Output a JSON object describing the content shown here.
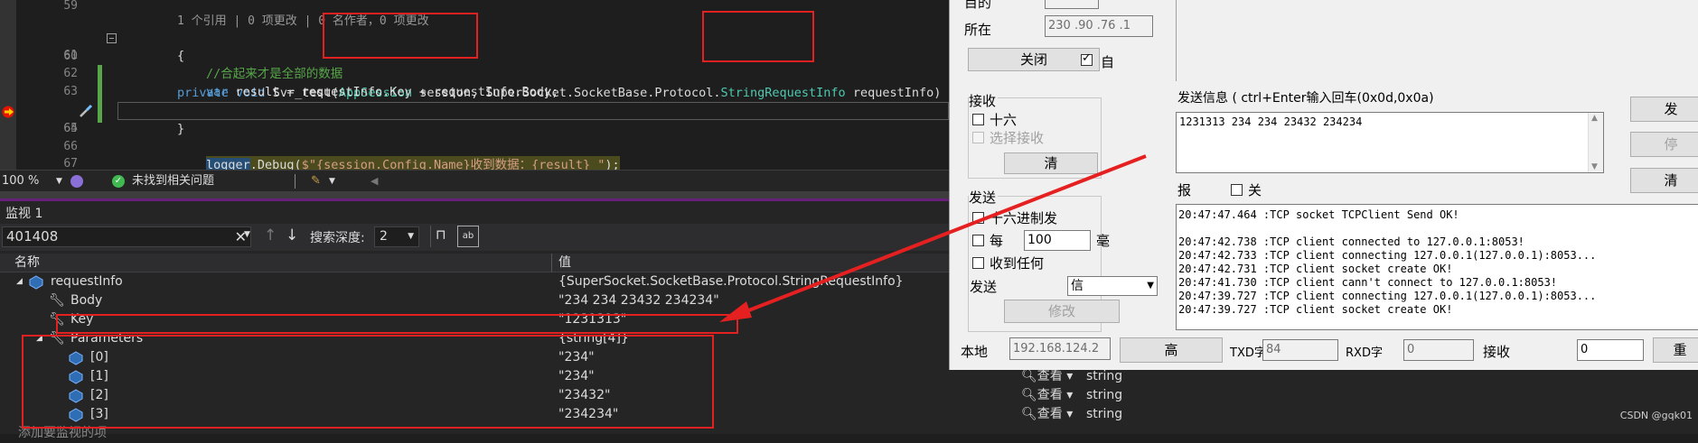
{
  "editor": {
    "line_numbers": [
      "59",
      "60",
      "61",
      "62",
      "63",
      "64",
      "65",
      "66",
      "67"
    ],
    "codelens": "1 个引用 | 0 项更改 | 0 名作者，0 项更改",
    "line60": {
      "kw1": "private",
      "kw2": "void",
      "name": "Svr_test(",
      "type1": "AppSession",
      "p1": " session, SuperSocket.SocketBase.Protocol.",
      "type2": "StringRequestInfo",
      "p2": " requestInfo)"
    },
    "line61": "{",
    "line62": "//合起来才是全部的数据",
    "line63": {
      "kw": "var",
      "rest": " result = requestInfo.Key + requestInfo.Body;"
    },
    "line64": {
      "obj": "logger",
      "call": ".Debug(",
      "str": "$\"{session.Config.Name}收到数据：{result} \"",
      "end": ");"
    },
    "line65": "}",
    "status": {
      "zoom": "100 %",
      "issues": "未找到相关问题"
    }
  },
  "watch": {
    "title": "监视 1",
    "search_value": "401408",
    "depth_label": "搜索深度:",
    "depth_value": "2",
    "col_name": "名称",
    "col_value": "值",
    "rows": [
      {
        "name": "requestInfo",
        "value": "{SuperSocket.SocketBase.Protocol.StringRequestInfo}"
      },
      {
        "name": "Body",
        "value": "\"234 234   23432   234234\""
      },
      {
        "name": "Key",
        "value": "\"1231313\""
      },
      {
        "name": "Parameters",
        "value": "{string[4]}"
      },
      {
        "name": "[0]",
        "value": "\"234\""
      },
      {
        "name": "[1]",
        "value": "\"234\""
      },
      {
        "name": "[2]",
        "value": "\"23432\""
      },
      {
        "name": "[3]",
        "value": "\"234234\""
      }
    ],
    "view_label": "查看",
    "type_label": "string",
    "add_label": "添加要监视的项"
  },
  "tool": {
    "top_label": "目的",
    "location_label": "所在",
    "ip_value": "230 .90 .76 .1",
    "close_btn": "关闭",
    "auto_label": "自",
    "recv_group": "接收",
    "hex16_label": "十六",
    "select_recv_label": "选择接收",
    "clear_btn": "清",
    "send_group": "发送",
    "hex_send_label": "十六进制发",
    "every_label": "每",
    "interval_value": "100",
    "ms_label": "毫",
    "recv_any_label": "收到任何",
    "send_label": "发送",
    "send_select": "信",
    "modify_btn": "修改",
    "send_info_label": "发送信息 ( ctrl+Enter输入回车(0x0d,0x0a)",
    "send_text": "1231313 234 234   23432   234234",
    "send_btn": "发",
    "stop_btn": "停",
    "clear2_btn": "清",
    "report_label": "报",
    "off_label": "关",
    "log_lines": [
      "20:47:47.464 :TCP socket TCPClient Send OK!",
      "",
      "20:47:42.738 :TCP client connected to 127.0.0.1:8053!",
      "20:47:42.733 :TCP client connecting 127.0.0.1(127.0.0.1):8053...",
      "20:47:42.731 :TCP client socket create OK!",
      "20:47:41.730 :TCP client cann't connect to 127.0.0.1:8053!",
      "20:47:39.727 :TCP client connecting 127.0.0.1(127.0.0.1):8053...",
      "20:47:39.727 :TCP client socket create OK!"
    ],
    "local_label": "本地",
    "local_ip": "192.168.124.2",
    "high_btn": "高",
    "txd_label": "TXD字",
    "txd_value": "84",
    "rxd_label": "RXD字",
    "rxd_value": "0",
    "recv_count_label": "接收",
    "recv_count_value": "0",
    "reset_btn": "重"
  },
  "watermark": "CSDN @gqk01",
  "colors": {
    "annotation": "#e52020",
    "accent": "#68217a"
  }
}
